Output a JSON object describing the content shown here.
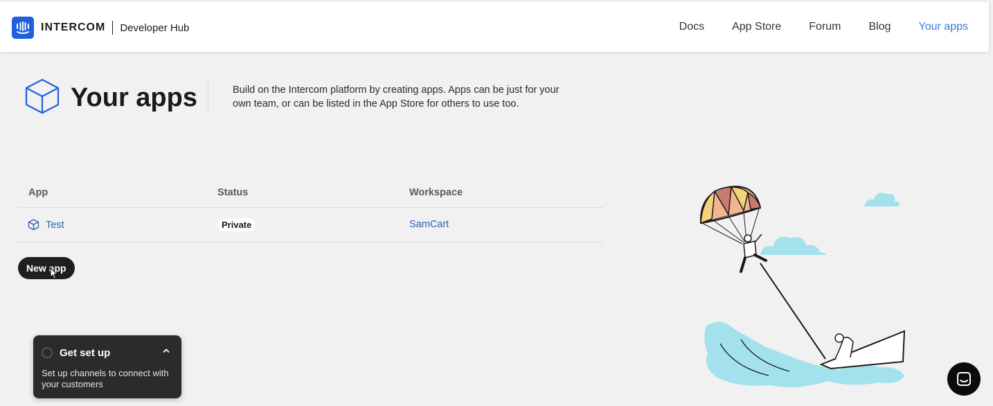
{
  "nav": {
    "brand": "INTERCOM",
    "subtitle": "Developer Hub",
    "links": [
      "Docs",
      "App Store",
      "Forum",
      "Blog",
      "Your apps"
    ],
    "active": "Your apps"
  },
  "page": {
    "title": "Your apps",
    "description": "Build on the Intercom platform by creating apps. Apps can be just for your own team, or can be listed in the App Store for others to use too."
  },
  "table": {
    "headers": [
      "App",
      "Status",
      "Workspace"
    ],
    "rows": [
      {
        "app": "Test",
        "status": "Private",
        "workspace": "SamCart"
      }
    ]
  },
  "actions": {
    "new_app": "New app"
  },
  "setup_widget": {
    "title": "Get set up",
    "text": "Set up channels to connect with your customers"
  },
  "icons": {
    "logo": "intercom-logo-icon",
    "apps": "cube-icon",
    "chat": "messenger-icon"
  },
  "colors": {
    "brand": "#1f5fe0",
    "link": "#2f5fb3",
    "active_nav": "#3a7bd5",
    "background": "#f1f1f1"
  }
}
